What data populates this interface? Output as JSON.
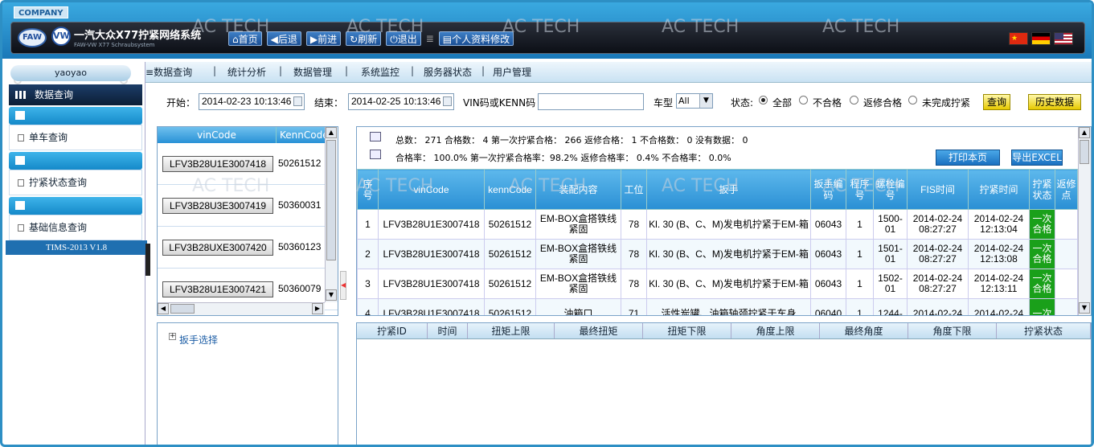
{
  "header": {
    "company": "COMPANY",
    "logo_text": "FAW",
    "vw_text": "VW",
    "title": "一汽大众X77拧紧网络系统",
    "subtitle": "FAW-VW X77 Schraubsystem",
    "nav": [
      {
        "icon": "home-icon",
        "label": "首页"
      },
      {
        "icon": "back-icon",
        "label": "后退"
      },
      {
        "icon": "forward-icon",
        "label": "前进"
      },
      {
        "icon": "refresh-icon",
        "label": "刷新"
      },
      {
        "icon": "power-icon",
        "label": "退出"
      },
      {
        "icon": "profile-icon",
        "label": "个人资料修改"
      }
    ],
    "flags": [
      "china-flag-icon",
      "germany-flag-icon",
      "usa-flag-icon"
    ]
  },
  "watermark": "AC TECH",
  "sidebar": {
    "user": "yaoyao",
    "section": "数据查询",
    "items": [
      {
        "label": "单车查询"
      },
      {
        "label": "拧紧状态查询"
      },
      {
        "label": "基础信息查询"
      }
    ],
    "version": "TIMS-2013 V1.8"
  },
  "tabs": [
    "数据查询",
    "统计分析",
    "数据管理",
    "系统监控",
    "服务器状态",
    "用户管理"
  ],
  "filter": {
    "start_label": "开始：",
    "start_value": "2014-02-23 10:13:46",
    "end_label": "结束：",
    "end_value": "2014-02-25 10:13:46",
    "vin_label": "VIN码或KENN码",
    "vin_value": "",
    "type_label": "车型",
    "type_value": "All",
    "status_label": "状态:",
    "status_options": [
      "全部",
      "不合格",
      "返修合格",
      "未完成拧紧"
    ],
    "status_selected": "全部",
    "query_button": "查询",
    "history_button": "历史数据"
  },
  "vin_list": {
    "columns": [
      "vinCode",
      "KennCode"
    ],
    "rows": [
      {
        "vin": "LFV3B28U1E3007418",
        "kenn": "50261512"
      },
      {
        "vin": "LFV3B28U3E3007419",
        "kenn": "50360031"
      },
      {
        "vin": "LFV3B28UXE3007420",
        "kenn": "50360123"
      },
      {
        "vin": "LFV3B28U1E3007421",
        "kenn": "50360079"
      }
    ]
  },
  "tree": {
    "node": "扳手选择"
  },
  "summary": {
    "line1": "总数： 271   合格数： 4   第一次拧紧合格： 266   返修合格： 1   不合格数： 0   没有数据： 0",
    "line2": "合格率： 100.0%   第一次拧紧合格率：98.2%   返修合格率： 0.4%   不合格率： 0.0%",
    "print_button": "打印本页",
    "excel_button": "导出EXCEL"
  },
  "main_table": {
    "headers": [
      "序号",
      "vinCode",
      "kennCode",
      "装配内容",
      "工位",
      "扳手",
      "扳手编码",
      "程序号",
      "螺栓编号",
      "FIS时间",
      "拧紧时间",
      "拧紧状态",
      "返修点"
    ],
    "rows": [
      [
        "1",
        "LFV3B28U1E3007418",
        "50261512",
        "EM-BOX盒搭铁线紧固",
        "78",
        "Kl. 30 (B、C、M)发电机拧紧于EM-箱",
        "06043",
        "1",
        "1500-01",
        "2014-02-24 08:27:27",
        "2014-02-24 12:13:04",
        "一次合格",
        ""
      ],
      [
        "2",
        "LFV3B28U1E3007418",
        "50261512",
        "EM-BOX盒搭铁线紧固",
        "78",
        "Kl. 30 (B、C、M)发电机拧紧于EM-箱",
        "06043",
        "1",
        "1501-01",
        "2014-02-24 08:27:27",
        "2014-02-24 12:13:08",
        "一次合格",
        ""
      ],
      [
        "3",
        "LFV3B28U1E3007418",
        "50261512",
        "EM-BOX盒搭铁线紧固",
        "78",
        "Kl. 30 (B、C、M)发电机拧紧于EM-箱",
        "06043",
        "1",
        "1502-01",
        "2014-02-24 08:27:27",
        "2014-02-24 12:13:11",
        "一次合格",
        ""
      ],
      [
        "4",
        "LFV3B28U1E3007418",
        "50261512",
        "油箱口",
        "71",
        "活性炭罐、油箱轴颈拧紧于车身",
        "06040",
        "1",
        "1244-",
        "2014-02-24",
        "2014-02-24",
        "一次",
        ""
      ]
    ]
  },
  "detail_table": {
    "headers": [
      "拧紧ID",
      "时间",
      "扭矩上限",
      "最终扭矩",
      "扭矩下限",
      "角度上限",
      "最终角度",
      "角度下限",
      "拧紧状态"
    ]
  },
  "colors": {
    "accent": "#2a8fd4",
    "ok": "#1aa01a",
    "query_button": "#e7c900"
  }
}
